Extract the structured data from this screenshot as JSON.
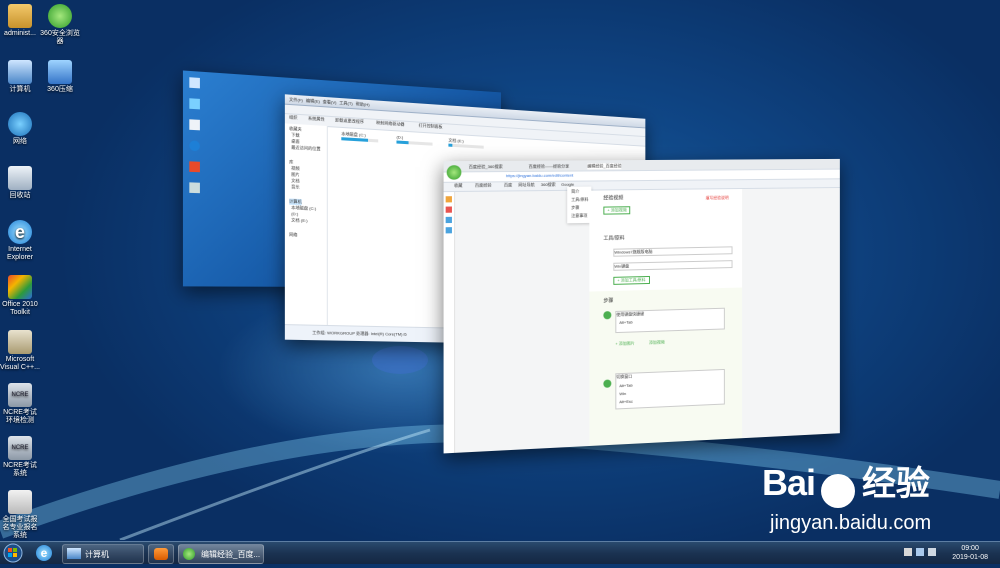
{
  "desktop": {
    "icons": [
      {
        "label": "administ...",
        "icon": "user-folder-icon"
      },
      {
        "label": "360安全浏览器",
        "icon": "360-browser-icon"
      },
      {
        "label": "计算机",
        "icon": "computer-icon"
      },
      {
        "label": "360压缩",
        "icon": "360-zip-icon"
      },
      {
        "label": "网络",
        "icon": "network-icon"
      },
      {
        "label": "回收站",
        "icon": "recycle-bin-icon"
      },
      {
        "label": "Internet Explorer",
        "icon": "ie-icon"
      },
      {
        "label": "Office 2010 Toolkit",
        "icon": "office-toolkit-icon"
      },
      {
        "label": "Microsoft Visual C++...",
        "icon": "visual-cpp-icon"
      },
      {
        "label": "NCRE考试环境检测",
        "icon": "ncre-check-icon"
      },
      {
        "label": "NCRE考试系统",
        "icon": "ncre-exam-icon"
      },
      {
        "label": "全国考试报名专业报名系统",
        "icon": "exam-signup-icon"
      }
    ]
  },
  "windows": {
    "explorer": {
      "menu": [
        "文件(F)",
        "编辑(E)",
        "查看(V)",
        "工具(T)",
        "帮助(H)"
      ],
      "toolbar": [
        "组织",
        "系统属性",
        "卸载或更改程序",
        "映射网络驱动器",
        "打开控制面板"
      ],
      "nav": [
        "收藏夹",
        "下载",
        "桌面",
        "最近访问的位置",
        "库",
        "视频",
        "图片",
        "文档",
        "音乐",
        "计算机",
        "本地磁盘 (C:)",
        "(D:)",
        "文档 (E:)",
        "网络"
      ],
      "drives": [
        {
          "name": "本地磁盘 (C:)",
          "fill": 0.72
        },
        {
          "name": "(D:)",
          "fill": 0.34
        },
        {
          "name": "文档 (E:)",
          "fill": 0.12
        }
      ],
      "status": "工作组: WORKGROUP   处理器: Intel(R) Core(TM) i5"
    },
    "browser": {
      "tabs": [
        "百度经验_360搜索",
        "百度经验——经验分享",
        "编辑经验_百度经验"
      ],
      "url": "https://jingyan.baidu.com/edit/content",
      "bookmarks": [
        "收藏",
        "百度经验",
        "百度",
        "网址导航",
        "360搜索",
        "Google"
      ],
      "side_menu": [
        "简介",
        "工具/原料",
        "步骤",
        "注意事项"
      ],
      "sections": {
        "video": "经验视频",
        "video_btn": "+ 添加视频",
        "tools_title": "工具/原料",
        "tool_items": [
          "Windows7旗舰版电脑",
          "Win键盘"
        ],
        "add_tool": "+ 添加工具/原料",
        "steps_title": "步骤",
        "step1": [
          "使用键盘快捷键",
          "Alt+Tab"
        ],
        "step2": [
          "切换窗口",
          "Alt+Tab",
          "Win",
          "Alt+Esc"
        ],
        "add_image": "+ 添加图片",
        "add_video": "添加视频",
        "report": "填写经验说明"
      }
    }
  },
  "taskbar": {
    "buttons": [
      {
        "label": "计算机",
        "icon": "explorer-icon"
      },
      {
        "label": "",
        "icon": "media-player-icon"
      },
      {
        "label": "编辑经验_百度...",
        "icon": "360-browser-icon"
      }
    ],
    "time": "09:00",
    "date": "2019-01-08"
  },
  "watermark": {
    "brand": "Bai",
    "brand2": "经验",
    "url": "jingyan.baidu.com"
  },
  "colors": {
    "accent": "#26a0da",
    "brand_green": "#4caf50",
    "baidu_blue": "#2a6fdb"
  }
}
